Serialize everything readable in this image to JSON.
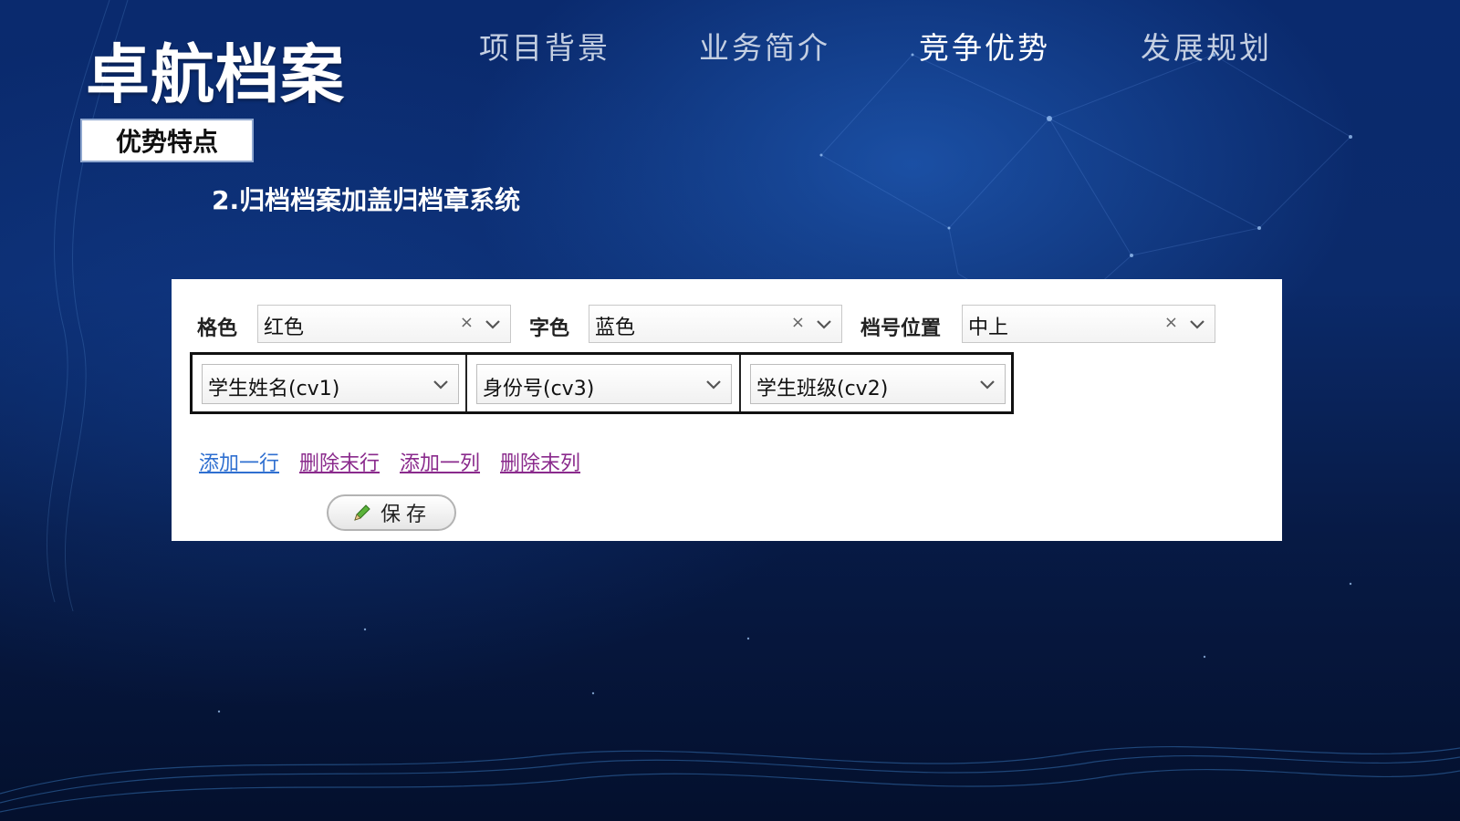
{
  "brand": {
    "title": "卓航档案"
  },
  "nav": {
    "items": [
      {
        "label": "项目背景"
      },
      {
        "label": "业务简介"
      },
      {
        "label": "竞争优势"
      },
      {
        "label": "发展规划"
      }
    ],
    "active_index": 2
  },
  "section": {
    "tag": "优势特点",
    "subtitle": "2.归档档案加盖归档章系统"
  },
  "form": {
    "fields": [
      {
        "label": "格色",
        "value": "红色",
        "clear_icon": "close-icon",
        "toggle_icon": "chevron-down-icon"
      },
      {
        "label": "字色",
        "value": "蓝色",
        "clear_icon": "close-icon",
        "toggle_icon": "chevron-down-icon"
      },
      {
        "label": "档号位置",
        "value": "中上",
        "clear_icon": "close-icon",
        "toggle_icon": "chevron-down-icon"
      }
    ],
    "clear_glyph": "×",
    "columns": [
      {
        "value": "学生姓名(cv1)"
      },
      {
        "value": "身份号(cv3)"
      },
      {
        "value": "学生班级(cv2)"
      }
    ],
    "links": [
      {
        "label": "添加一行",
        "color": "#2f6fd0"
      },
      {
        "label": "删除末行",
        "color": "#8a2a8c"
      },
      {
        "label": "添加一列",
        "color": "#8a2a8c"
      },
      {
        "label": "删除末列",
        "color": "#8a2a8c"
      }
    ],
    "save_button": {
      "label": "保存",
      "icon": "pencil-icon"
    }
  },
  "colors": {
    "nav_active": "#ffffff",
    "nav_inactive": "#c4cfe2",
    "panel_bg": "#ffffff"
  }
}
